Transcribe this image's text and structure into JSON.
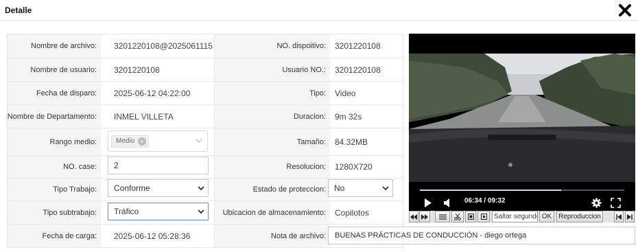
{
  "dialog": {
    "title": "Detalle"
  },
  "fields": {
    "nombre_archivo": {
      "label": "Nombre de archivo:",
      "value": "3201220108@2025061115"
    },
    "no_dispositivo": {
      "label": "NO. dispoitivo:",
      "value": "3201220108"
    },
    "nombre_usuario": {
      "label": "Nombre de usuario:",
      "value": "3201220108"
    },
    "usuario_no": {
      "label": "Usuario NO.:",
      "value": "3201220108"
    },
    "fecha_disparo": {
      "label": "Fecha de disparo:",
      "value": "2025-06-12 04:22:00"
    },
    "tipo": {
      "label": "Tipo:",
      "value": "Video"
    },
    "departamento": {
      "label": "Nombre de Departamento:",
      "value": "INMEL VILLETA"
    },
    "duracion": {
      "label": "Duracion:",
      "value": "9m 32s"
    },
    "rango_medio": {
      "label": "Rango medio:",
      "chip": "Medio",
      "chip_remove": "×"
    },
    "tamano": {
      "label": "Tamaño:",
      "value": "84.32MB"
    },
    "no_case": {
      "label": "NO. case:",
      "value": "2"
    },
    "resolucion": {
      "label": "Resolucion:",
      "value": "1280X720"
    },
    "tipo_trabajo": {
      "label": "Tipo Trabajo:",
      "value": "Conforme"
    },
    "estado_proteccion": {
      "label": "Estado de proteccion:",
      "value": "No"
    },
    "tipo_subtrabajo": {
      "label": "Tipo subtrabajo:",
      "value": "Tráfico"
    },
    "ubicacion": {
      "label": "Ubicacion de almacenamiento:",
      "value": "Copilotos"
    },
    "fecha_carga": {
      "label": "Fecha de carga:",
      "value": "2025-06-12 05:28:36"
    },
    "nota_archivo": {
      "label": "Nota de archivo:",
      "value": "BUENAS PRÁCTICAS DE CONDUCCIÓN - diego ortega"
    }
  },
  "player": {
    "time": "06:34 / 09:32",
    "progress_fraction": 0.69,
    "icons": [
      "play-icon",
      "volume-icon",
      "settings-icon",
      "fullscreen-icon"
    ],
    "toolbar": {
      "icons": [
        "fast-backward-icon",
        "fast-forward-icon",
        "list-icon",
        "scissors-icon",
        "frame-icon",
        "play-frame-icon",
        "skip-start-icon",
        "skip-end-icon"
      ],
      "skip_placeholder": "Saltar segundo",
      "ok_label": "OK",
      "playback_label": "Reproduccion"
    }
  },
  "colors": {
    "focus_border": "#5a8fd6",
    "label_bg": "#f5f5f5"
  }
}
